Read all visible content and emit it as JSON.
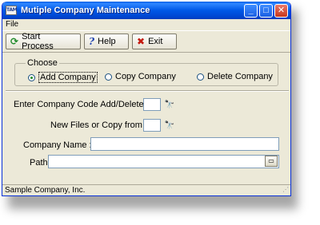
{
  "window": {
    "title": "Mutiple Company Maintenance",
    "app_icon_text": "TAM",
    "controls": {
      "minimize": "_",
      "maximize": "□",
      "close": "✕"
    }
  },
  "menu": {
    "items": [
      "File"
    ]
  },
  "toolbar": {
    "start_label": "Start Process",
    "help_label": "Help",
    "exit_label": "Exit"
  },
  "choose": {
    "legend": "Choose",
    "options": [
      {
        "label": "Add Company",
        "selected": true
      },
      {
        "label": "Copy Company",
        "selected": false
      },
      {
        "label": "Delete Company",
        "selected": false
      }
    ]
  },
  "form": {
    "company_code_label": "Enter Company Code Add/Delete? :",
    "company_code_value": "",
    "copy_from_label": "New Files or Copy from :",
    "copy_from_value": "",
    "company_name_label": "Company Name :",
    "company_name_value": "",
    "path_label": "Path",
    "path_value": ""
  },
  "status": {
    "text": "Sample Company, Inc."
  }
}
